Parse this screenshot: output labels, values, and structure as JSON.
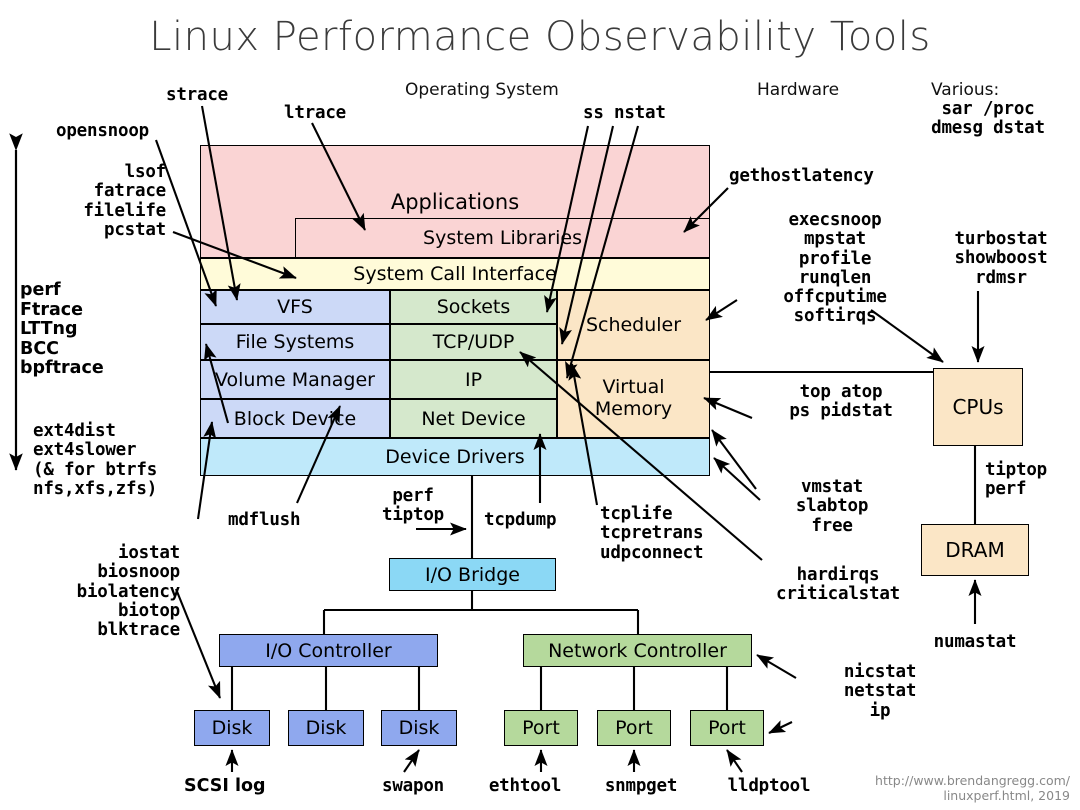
{
  "title": "Linux Performance Observability Tools",
  "captions": {
    "operating_system": "Operating System",
    "hardware": "Hardware",
    "various": "Various:"
  },
  "colors": {
    "applications": "#fad4d4",
    "syscall": "#fffbd9",
    "filesystem": "#ccd9f7",
    "network": "#d5e8cc",
    "scheduler": "#fbe6c6",
    "device_drivers": "#bfe9fa",
    "io_bridge": "#8bd8f5",
    "io_controller": "#8fa8ee",
    "network_controller": "#b5d99c",
    "cpus": "#fbe6c6"
  },
  "kernel_blocks": {
    "applications": "Applications",
    "system_libraries": "System Libraries",
    "system_call_interface": "System Call Interface",
    "vfs": "VFS",
    "file_systems": "File Systems",
    "volume_manager": "Volume Manager",
    "block_device": "Block Device",
    "sockets": "Sockets",
    "tcp_udp": "TCP/UDP",
    "ip": "IP",
    "net_device": "Net Device",
    "scheduler": "Scheduler",
    "virtual_memory": "Virtual\nMemory",
    "device_drivers": "Device Drivers"
  },
  "hardware_blocks": {
    "cpus": "CPUs",
    "dram": "DRAM",
    "io_bridge": "I/O Bridge",
    "io_controller": "I/O Controller",
    "network_controller": "Network Controller",
    "disk1": "Disk",
    "disk2": "Disk",
    "disk3": "Disk",
    "port1": "Port",
    "port2": "Port",
    "port3": "Port"
  },
  "tools": {
    "strace": "strace",
    "ltrace": "ltrace",
    "opensnoop": "opensnoop",
    "ss_nstat": "ss nstat",
    "various_list": "sar /proc\ndmesg dstat",
    "file_tools": "lsof\nfatrace\nfilelife\npcstat",
    "tracers": "perf\nFtrace\nLTTng\nBCC\nbpftrace",
    "ext4": "ext4dist\next4slower\n(& for btrfs\nnfs,xfs,zfs)",
    "block_tools": "iostat\nbiosnoop\nbiolatency\nbiotop\nblktrace",
    "mdflush": "mdflush",
    "perf_tiptop": "perf\ntiptop",
    "tcpdump": "tcpdump",
    "tcp_tools": "tcplife\ntcpretrans\nudpconnect",
    "gethostlatency": "gethostlatency",
    "sched_tools": "execsnoop\nmpstat\nprofile\nrunqlen\noffcputime\nsoftirqs",
    "cpu_tools": "turbostat\nshowboost\nrdmsr",
    "proc_tools": "top atop\nps pidstat",
    "mem_tools": "vmstat\nslabtop\nfree",
    "irq_tools": "hardirqs\ncriticalstat",
    "dram_tools": "tiptop\nperf",
    "numastat": "numastat",
    "nic_tools": "nicstat\nnetstat\nip",
    "scsi_log": "SCSI log",
    "swapon": "swapon",
    "ethtool": "ethtool",
    "snmpget": "snmpget",
    "lldptool": "lldptool"
  },
  "credit": {
    "line1": "http://www.brendangregg.com/",
    "line2": "linuxperf.html, 2019"
  }
}
